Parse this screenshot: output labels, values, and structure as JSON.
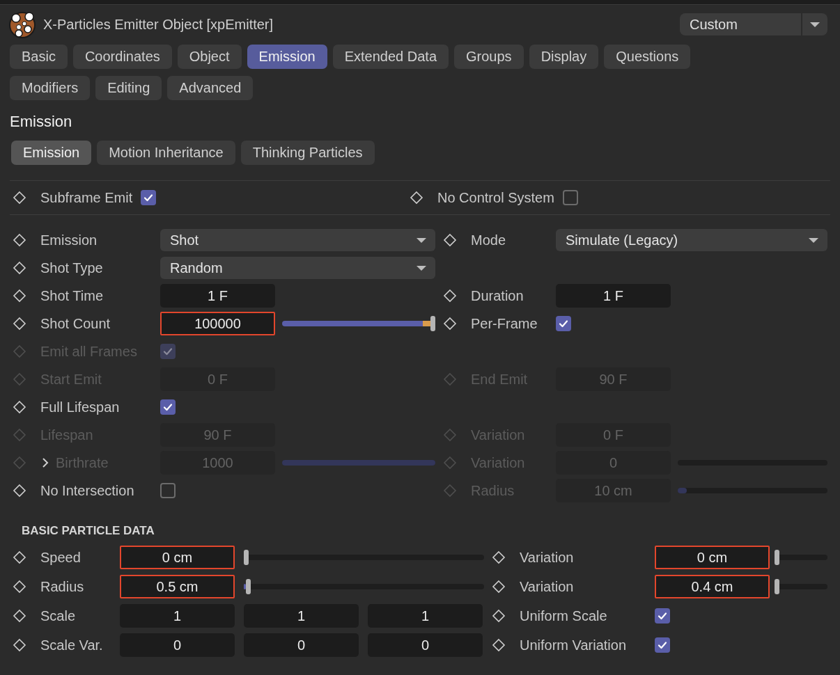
{
  "header": {
    "title": "X-Particles Emitter Object [xpEmitter]",
    "preset": "Custom"
  },
  "tabs": [
    {
      "label": "Basic",
      "selected": false
    },
    {
      "label": "Coordinates",
      "selected": false
    },
    {
      "label": "Object",
      "selected": false
    },
    {
      "label": "Emission",
      "selected": true
    },
    {
      "label": "Extended Data",
      "selected": false
    },
    {
      "label": "Groups",
      "selected": false
    },
    {
      "label": "Display",
      "selected": false
    },
    {
      "label": "Questions",
      "selected": false
    },
    {
      "label": "Modifiers",
      "selected": false
    },
    {
      "label": "Editing",
      "selected": false
    },
    {
      "label": "Advanced",
      "selected": false
    }
  ],
  "section_title": "Emission",
  "subtabs": [
    {
      "label": "Emission",
      "selected": true
    },
    {
      "label": "Motion Inheritance",
      "selected": false
    },
    {
      "label": "Thinking Particles",
      "selected": false
    }
  ],
  "top_row": [
    {
      "kind": "checkbox",
      "label": "Subframe Emit",
      "enabled": true,
      "checked": true
    },
    {
      "kind": "checkbox",
      "label": "No Control System",
      "enabled": true,
      "checked": false
    }
  ],
  "params": [
    {
      "left": {
        "kind": "dropdown",
        "label": "Emission",
        "enabled": true,
        "value": "Shot"
      },
      "right": {
        "kind": "dropdown",
        "label": "Mode",
        "enabled": true,
        "value": "Simulate (Legacy)"
      }
    },
    {
      "left": {
        "kind": "dropdown",
        "label": "Shot Type",
        "enabled": true,
        "value": "Random"
      }
    },
    {
      "left": {
        "kind": "field",
        "label": "Shot Time",
        "enabled": true,
        "value": "1 F"
      },
      "right": {
        "kind": "field",
        "label": "Duration",
        "enabled": true,
        "value": "1 F"
      }
    },
    {
      "left": {
        "kind": "field_slider",
        "label": "Shot Count",
        "enabled": true,
        "value": "100000",
        "level": 1,
        "highlighted": true
      },
      "right": {
        "kind": "checkbox",
        "label": "Per-Frame",
        "enabled": true,
        "checked": true
      }
    },
    {
      "left": {
        "kind": "checkbox",
        "label": "Emit all Frames",
        "enabled": false,
        "checked": true
      }
    },
    {
      "left": {
        "kind": "field",
        "label": "Start Emit",
        "enabled": false,
        "value": "0 F"
      },
      "right": {
        "kind": "field",
        "label": "End Emit",
        "enabled": false,
        "value": "90 F"
      }
    },
    {
      "left": {
        "kind": "checkbox",
        "label": "Full Lifespan",
        "enabled": true,
        "checked": true
      }
    },
    {
      "left": {
        "kind": "field",
        "label": "Lifespan",
        "enabled": false,
        "value": "90 F"
      },
      "right": {
        "kind": "field",
        "label": "Variation",
        "enabled": false,
        "value": "0 F"
      }
    },
    {
      "left": {
        "kind": "field_slider",
        "label": "Birthrate",
        "enabled": false,
        "value": "1000",
        "level": 1,
        "expanded": false
      },
      "right": {
        "kind": "field_slider",
        "label": "Variation",
        "enabled": false,
        "value": "0",
        "level": 0
      }
    },
    {
      "left": {
        "kind": "checkbox",
        "label": "No Intersection",
        "enabled": true,
        "checked": false
      },
      "right": {
        "kind": "field_slider",
        "label": "Radius",
        "enabled": false,
        "value": "10 cm",
        "level": 0.06
      }
    }
  ],
  "particle_data": {
    "heading": "BASIC PARTICLE DATA",
    "rows": [
      {
        "left": {
          "kind": "field_slider",
          "label": "Speed",
          "enabled": true,
          "value": "0 cm",
          "level": 0,
          "highlighted": true
        },
        "right": {
          "kind": "field_slider",
          "label": "Variation",
          "enabled": true,
          "value": "0 cm",
          "level": 0,
          "highlighted": true
        }
      },
      {
        "left": {
          "kind": "field_slider",
          "label": "Radius",
          "enabled": true,
          "value": "0.5 cm",
          "level": 0.01,
          "highlighted": true
        },
        "right": {
          "kind": "field_slider",
          "label": "Variation",
          "enabled": true,
          "value": "0.4 cm",
          "level": 0,
          "highlighted": true
        }
      },
      {
        "left": {
          "kind": "multi_field",
          "label": "Scale",
          "enabled": true,
          "values": [
            "1",
            "1",
            "1"
          ]
        },
        "right": {
          "kind": "checkbox",
          "label": "Uniform Scale",
          "enabled": true,
          "checked": true
        }
      },
      {
        "left": {
          "kind": "multi_field",
          "label": "Scale Var.",
          "enabled": true,
          "values": [
            "0",
            "0",
            "0"
          ]
        },
        "right": {
          "kind": "checkbox",
          "label": "Uniform Variation",
          "enabled": true,
          "checked": true
        }
      }
    ]
  }
}
